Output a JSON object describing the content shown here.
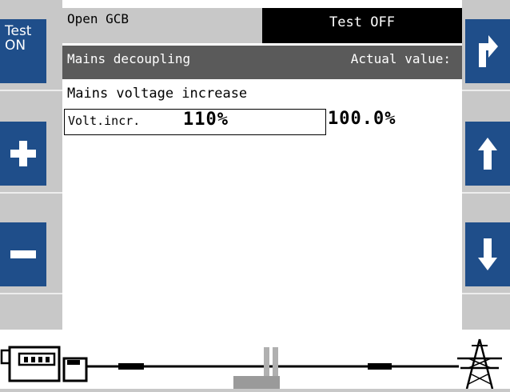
{
  "left_softkeys": {
    "test_line1": "Test",
    "test_line2": "ON"
  },
  "header": {
    "left_text": "Open GCB",
    "right_text": "Test OFF"
  },
  "subheader": {
    "title": "Mains decoupling",
    "actual_label": "Actual value:"
  },
  "content": {
    "function_name": "Mains voltage increase",
    "parameter_label": "Volt.incr.",
    "parameter_value": "110%",
    "actual_value": "100.0%"
  },
  "icons": {
    "left_plus": "plus-icon",
    "left_minus": "minus-icon",
    "right_top": "return-arrow-icon",
    "right_up": "arrow-up-icon",
    "right_down": "arrow-down-icon"
  },
  "colors": {
    "softkey_blue": "#1f4e8a",
    "panel_gray": "#c8c8c8",
    "subheader_gray": "#5a5a5a",
    "header_black": "#000000"
  }
}
